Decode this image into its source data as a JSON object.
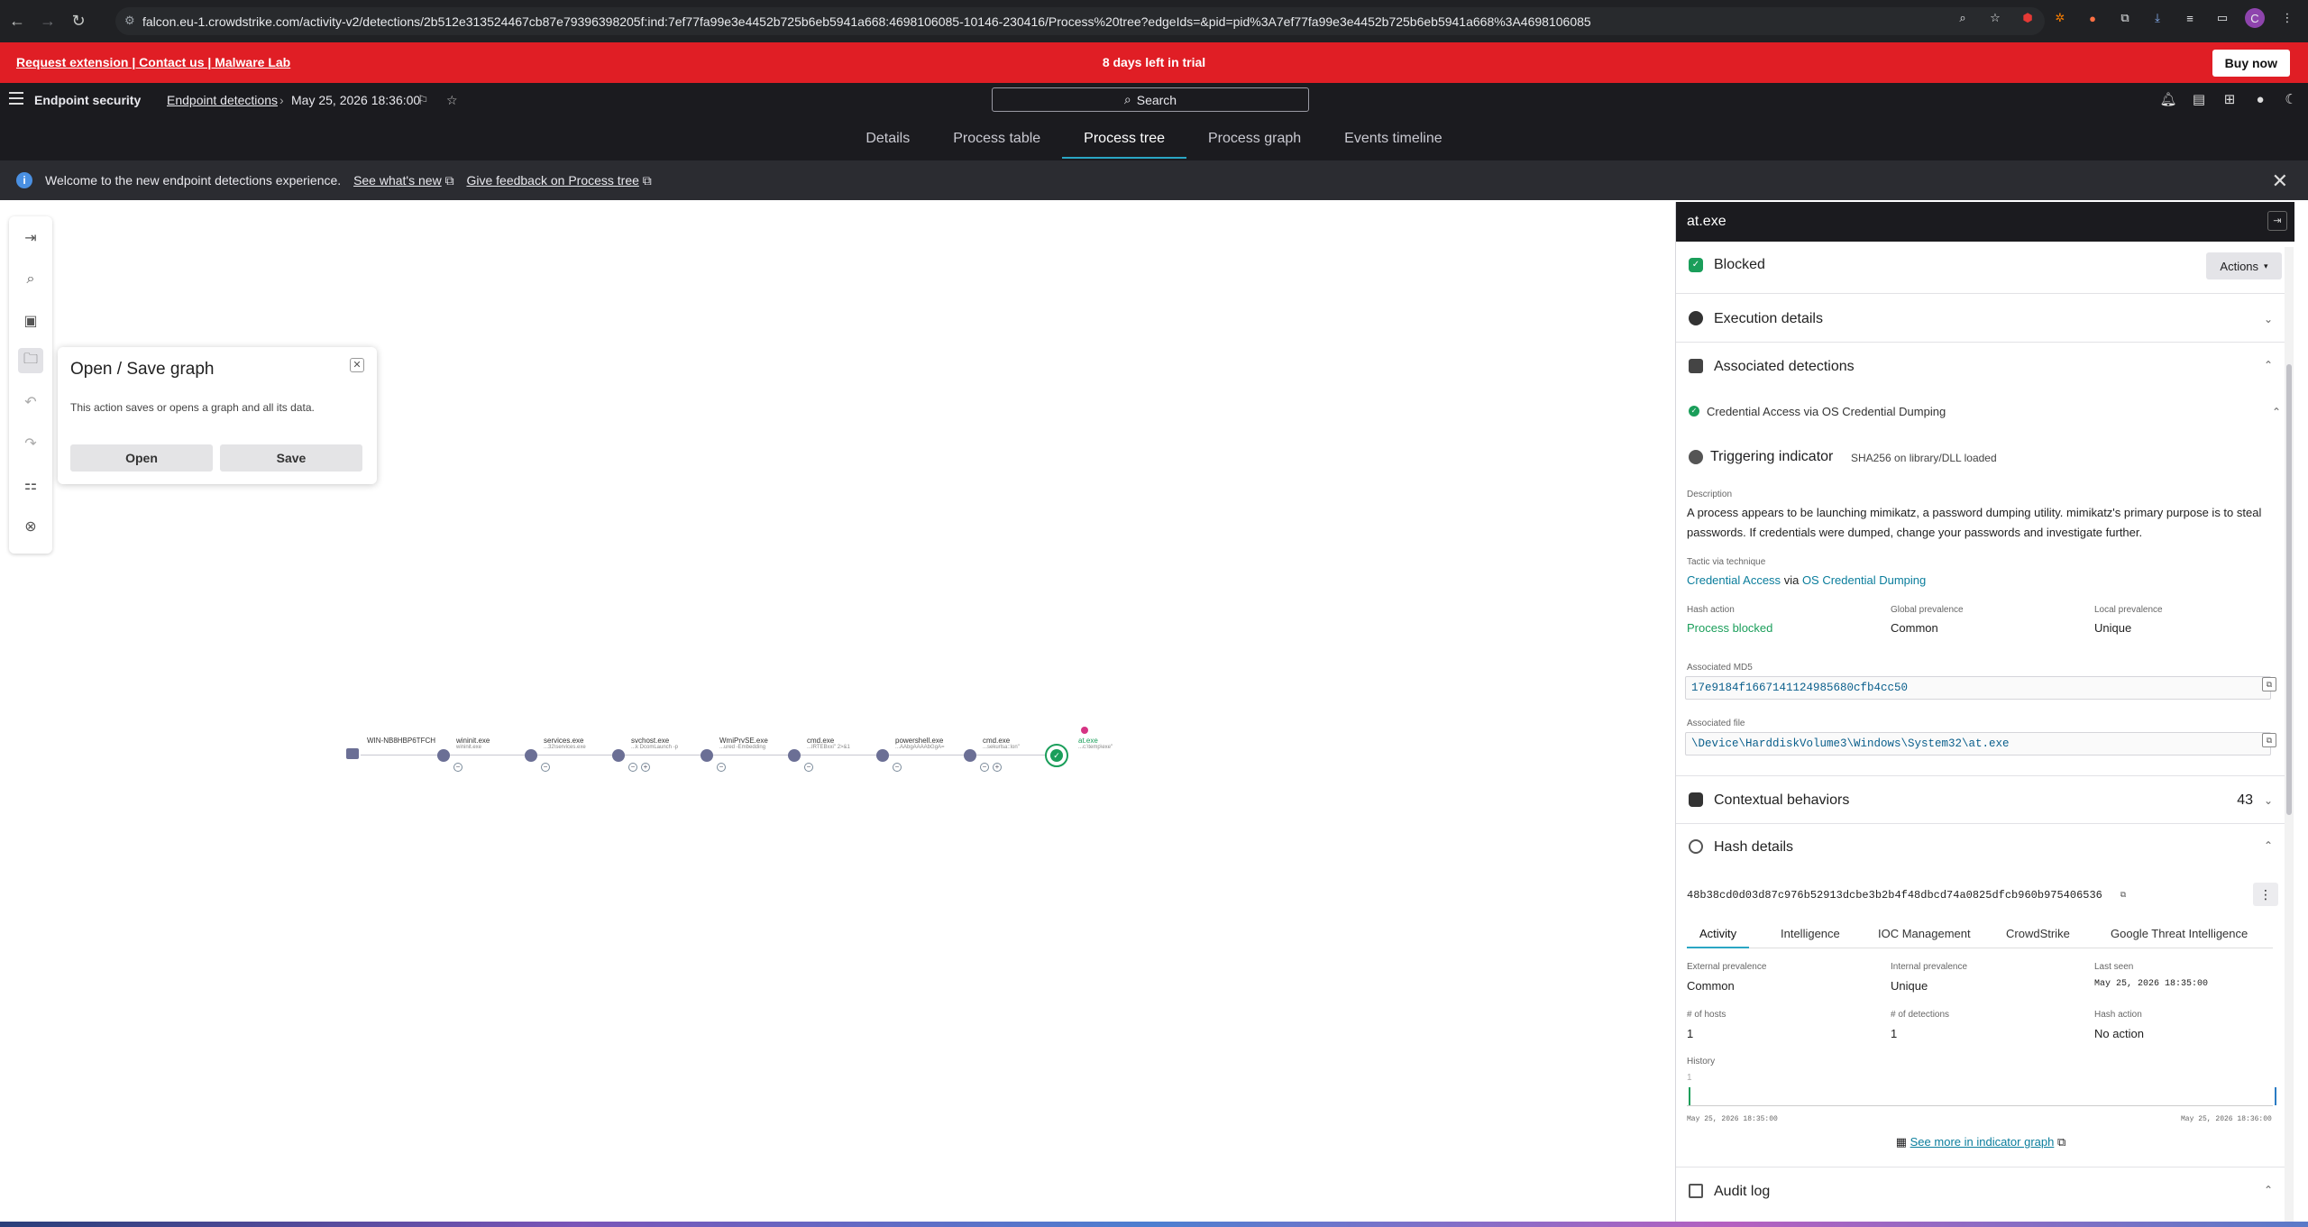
{
  "browser": {
    "url": "falcon.eu-1.crowdstrike.com/activity-v2/detections/2b512e313524467cb87e79396398205f:ind:7ef77fa99e3e4452b725b6eb5941a668:4698106085-10146-230416/Process%20tree?edgeIds=&pid=pid%3A7ef77fa99e3e4452b725b6eb5941a668%3A4698106085",
    "profile_letter": "C"
  },
  "trial_banner": {
    "links": "Request extension | Contact us | Malware Lab",
    "message": "8 days left in trial",
    "buy_label": "Buy now"
  },
  "header": {
    "app": "Endpoint security",
    "breadcrumb_link": "Endpoint detections",
    "breadcrumb_sep": "›",
    "date": "May 25, 2026 18:36:00",
    "search_label": "Search"
  },
  "tabs": [
    {
      "label": "Details"
    },
    {
      "label": "Process table"
    },
    {
      "label": "Process tree"
    },
    {
      "label": "Process graph"
    },
    {
      "label": "Events timeline"
    }
  ],
  "info_banner": {
    "message": "Welcome to the new endpoint detections experience.",
    "link1": "See what's new",
    "link2": "Give feedback on Process tree"
  },
  "popover": {
    "title": "Open / Save graph",
    "description": "This action saves or opens a graph and all its data.",
    "open_label": "Open",
    "save_label": "Save"
  },
  "graph_nodes": [
    {
      "label": "WIN-NB8HBP6TFCH",
      "sub": ""
    },
    {
      "label": "wininit.exe",
      "sub": "wininit.exe"
    },
    {
      "label": "services.exe",
      "sub": "...32\\services.exe"
    },
    {
      "label": "svchost.exe",
      "sub": "...k DcomLaunch -p"
    },
    {
      "label": "WmiPrvSE.exe",
      "sub": "...ured -Embedding"
    },
    {
      "label": "cmd.exe",
      "sub": "...IRTEBxxi\" 2>&1"
    },
    {
      "label": "powershell.exe",
      "sub": "...AAbgAAAAbGgA="
    },
    {
      "label": "cmd.exe",
      "sub": "...sekurlsa::lon\""
    },
    {
      "label": "at.exe",
      "sub": "...c:\\temp\\exe\""
    }
  ],
  "panel": {
    "title": "at.exe",
    "status": "Blocked",
    "actions_label": "Actions",
    "execution_details": "Execution details",
    "associated_detections": "Associated detections",
    "detection_name": "Credential Access via OS Credential Dumping",
    "triggering_indicator": "Triggering indicator",
    "indicator_sub": "SHA256 on library/DLL loaded",
    "description_label": "Description",
    "description_line1": "A process appears to be launching mimikatz, a password dumping utility. mimikatz's primary purpose is to steal",
    "description_line2": "passwords. If credentials were dumped, change your passwords and investigate further.",
    "tactic_label": "Tactic via technique",
    "tactic": "Credential Access",
    "via": "via",
    "technique": "OS Credential Dumping",
    "hash_action_label": "Hash action",
    "hash_action": "Process blocked",
    "global_prev_label": "Global prevalence",
    "global_prev": "Common",
    "local_prev_label": "Local prevalence",
    "local_prev": "Unique",
    "md5_label": "Associated MD5",
    "md5": "17e9184f1667141124985680cfb4cc50",
    "file_label": "Associated file",
    "file": "\\Device\\HarddiskVolume3\\Windows\\System32\\at.exe",
    "contextual": "Contextual behaviors",
    "contextual_count": "43",
    "hash_details": "Hash details",
    "sha256": "48b38cd0d03d87c976b52913dcbe3b2b4f48dbcd74a0825dfcb960b975406536",
    "subtabs": [
      "Activity",
      "Intelligence",
      "IOC Management",
      "CrowdStrike",
      "Google Threat Intelligence"
    ],
    "ext_prev_label": "External prevalence",
    "ext_prev": "Common",
    "int_prev_label": "Internal prevalence",
    "int_prev": "Unique",
    "last_seen_label": "Last seen",
    "last_seen": "May 25, 2026 18:35:00",
    "hosts_label": "# of hosts",
    "hosts": "1",
    "detections_label": "# of detections",
    "detections": "1",
    "hash_action2_label": "Hash action",
    "hash_action2": "No action",
    "history_label": "History",
    "history_y": "1",
    "history_start": "May 25, 2026 18:35:00",
    "history_end": "May 25, 2026 18:36:00",
    "see_more": "See more in indicator graph",
    "audit_log": "Audit log"
  },
  "colors": {
    "brand_red": "#e01e25",
    "accent_teal": "#2aa6c4",
    "success_green": "#1a9e5a",
    "link_teal": "#0a7d9c"
  }
}
